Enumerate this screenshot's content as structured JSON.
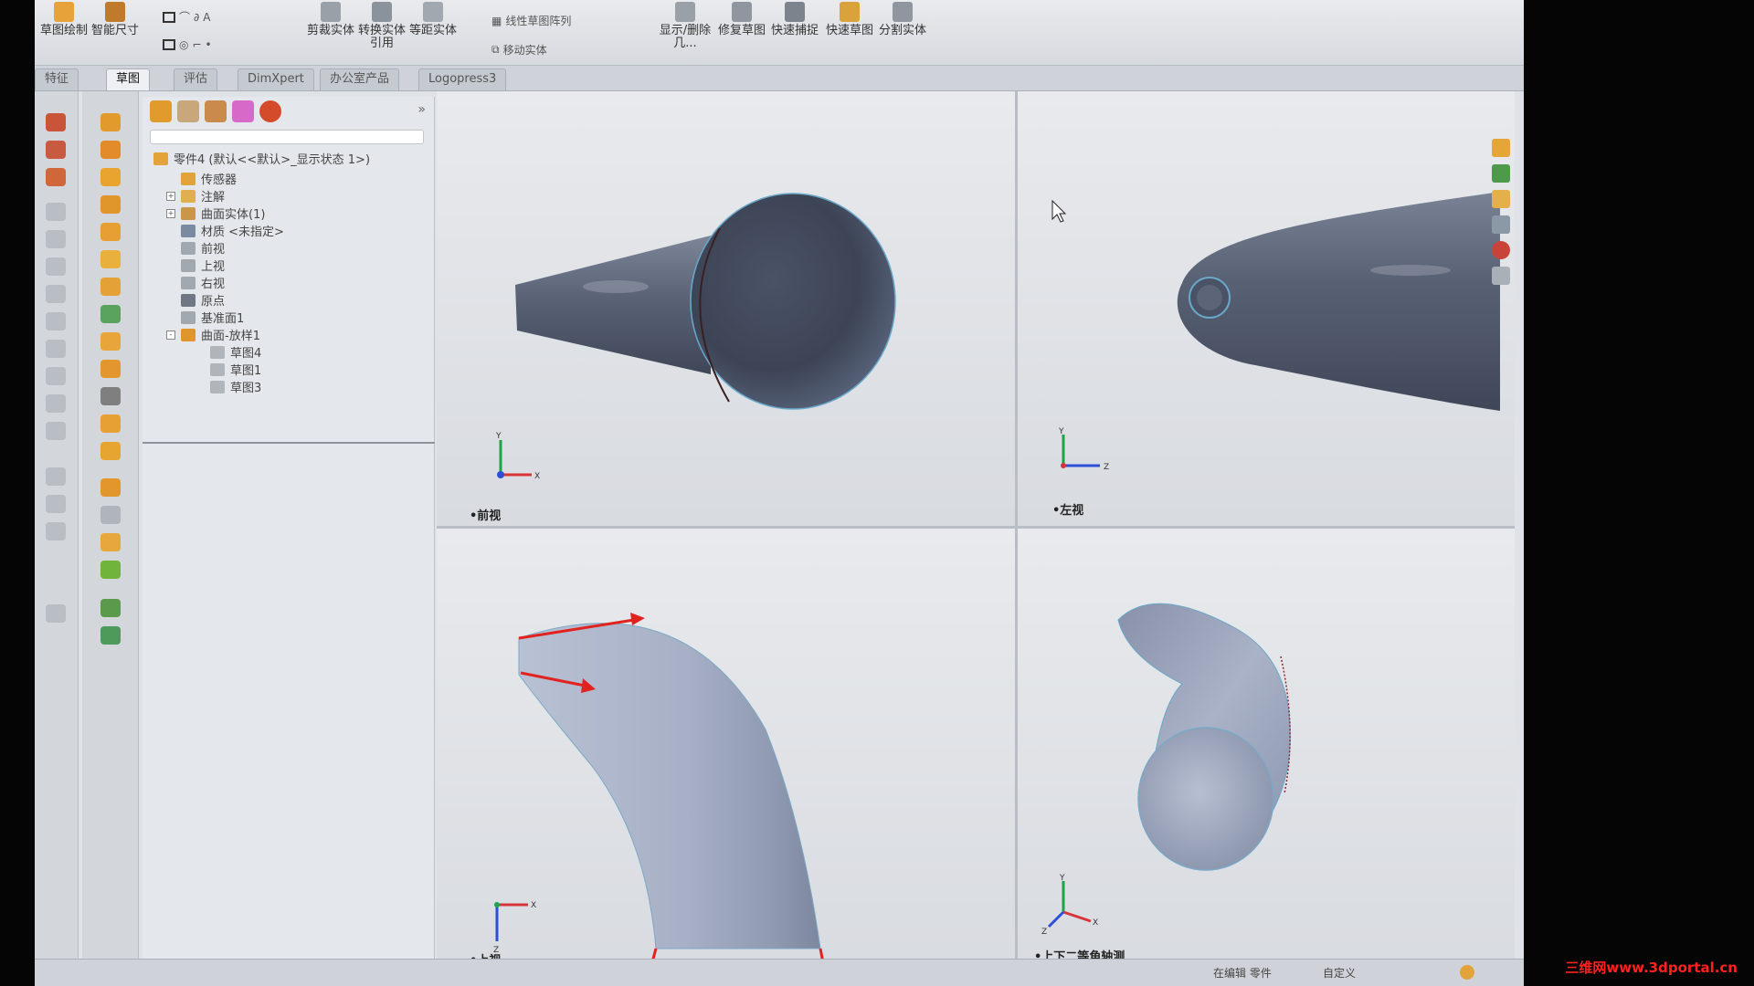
{
  "ribbon": {
    "sketch_drawing": "草图绘制",
    "smart_dimension": "智能尺寸",
    "trim_entities": "剪裁实体",
    "convert_entities": "转换实体引用",
    "offset_entities": "等距实体",
    "linear_pattern": "线性草图阵列",
    "move_entities": "移动实体",
    "display_delete": "显示/删除几...",
    "repair_sketch": "修复草图",
    "quick_snaps": "快速捕捉",
    "rapid_sketch": "快速草图",
    "split_entities": "分割实体"
  },
  "tabs": [
    "特征",
    "草图",
    "评估",
    "DimXpert",
    "办公室产品",
    "Logopress3"
  ],
  "active_tab": "草图",
  "feature_tree": {
    "root": "零件4 (默认<<默认>_显示状态 1>)",
    "items": [
      {
        "label": "传感器",
        "indent": 1,
        "expander": ""
      },
      {
        "label": "注解",
        "indent": 1,
        "expander": "+"
      },
      {
        "label": "曲面实体(1)",
        "indent": 1,
        "expander": "+"
      },
      {
        "label": "材质 <未指定>",
        "indent": 1,
        "expander": ""
      },
      {
        "label": "前视",
        "indent": 1,
        "expander": ""
      },
      {
        "label": "上视",
        "indent": 1,
        "expander": ""
      },
      {
        "label": "右视",
        "indent": 1,
        "expander": ""
      },
      {
        "label": "原点",
        "indent": 1,
        "expander": ""
      },
      {
        "label": "基准面1",
        "indent": 1,
        "expander": ""
      },
      {
        "label": "曲面-放样1",
        "indent": 1,
        "expander": "-"
      },
      {
        "label": "草图4",
        "indent": 2,
        "expander": ""
      },
      {
        "label": "草图1",
        "indent": 2,
        "expander": ""
      },
      {
        "label": "草图3",
        "indent": 2,
        "expander": ""
      }
    ]
  },
  "viewports": {
    "front": "•前视",
    "left": "•左视",
    "top": "•上视",
    "isometric": "•上下二等角轴测"
  },
  "status": {
    "editing": "在编辑 零件",
    "custom": "自定义"
  },
  "watermark": "三维网www.3dportal.cn",
  "colors": {
    "model": "#5a6376",
    "arrow": "#e0231f",
    "axis_y": "#1fa34a",
    "axis_x": "#d8343c",
    "axis_z": "#2d4fd8"
  }
}
